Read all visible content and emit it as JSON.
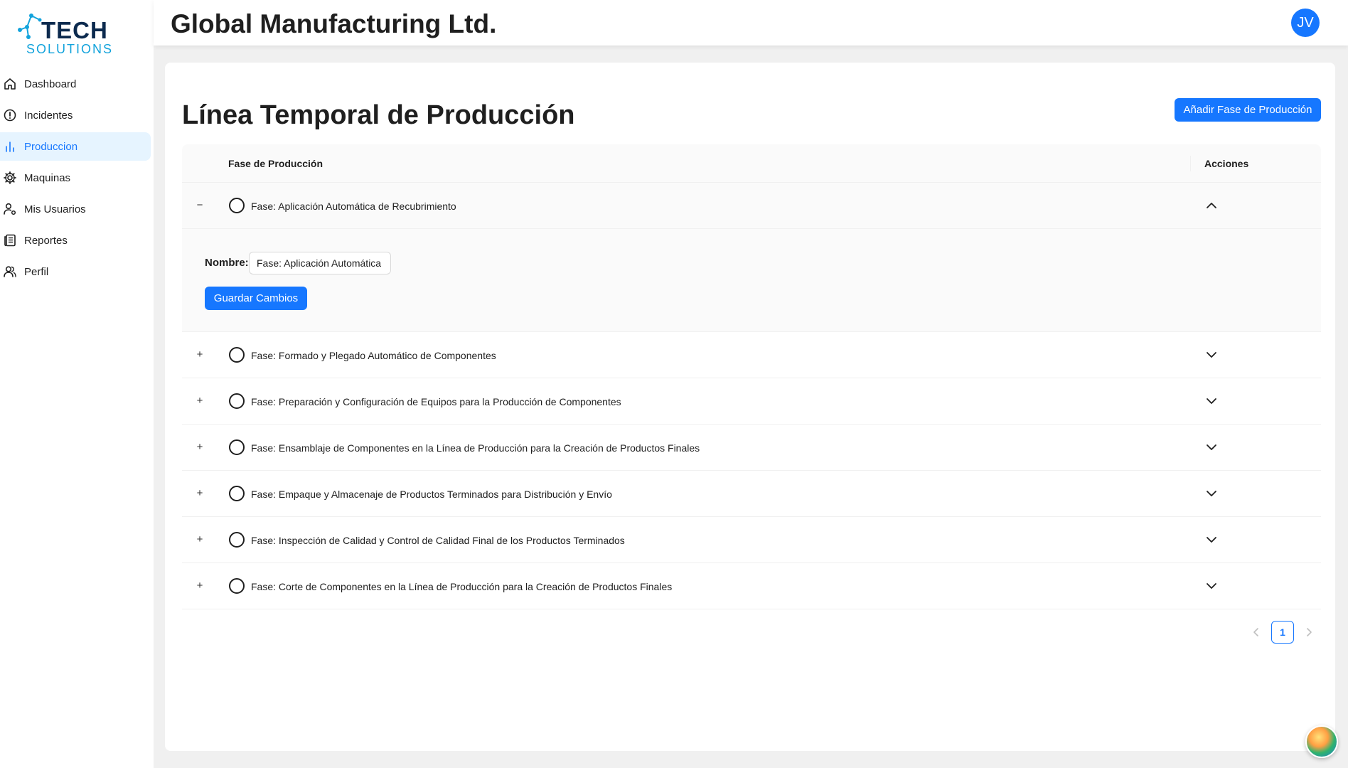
{
  "brand": {
    "logo_main": "TECH",
    "logo_sub": "SOLUTIONS",
    "primary_color": "#1677ff"
  },
  "sidebar": {
    "items": [
      {
        "label": "Dashboard",
        "icon": "home-icon",
        "active": false
      },
      {
        "label": "Incidentes",
        "icon": "alert-circle-icon",
        "active": false
      },
      {
        "label": "Produccion",
        "icon": "bar-chart-icon",
        "active": true
      },
      {
        "label": "Maquinas",
        "icon": "gear-icon",
        "active": false
      },
      {
        "label": "Mis Usuarios",
        "icon": "user-settings-icon",
        "active": false
      },
      {
        "label": "Reportes",
        "icon": "reports-icon",
        "active": false
      },
      {
        "label": "Perfil",
        "icon": "users-icon",
        "active": false
      }
    ]
  },
  "header": {
    "company": "Global Manufacturing Ltd.",
    "avatar_initials": "JV"
  },
  "main": {
    "title": "Línea Temporal de Producción",
    "add_button": "Añadir Fase de Producción",
    "table": {
      "col_phase": "Fase de Producción",
      "col_actions": "Acciones",
      "rows": [
        {
          "name": "Fase: Aplicación Automática de Recubrimiento",
          "expanded": true,
          "expand_symbol": "−"
        },
        {
          "name": "Fase: Formado y Plegado Automático de Componentes",
          "expanded": false,
          "expand_symbol": "+"
        },
        {
          "name": "Fase: Preparación y Configuración de Equipos para la Producción de Componentes",
          "expanded": false,
          "expand_symbol": "+"
        },
        {
          "name": "Fase: Ensamblaje de Componentes en la Línea de Producción para la Creación de Productos Finales",
          "expanded": false,
          "expand_symbol": "+"
        },
        {
          "name": "Fase: Empaque y Almacenaje de Productos Terminados para Distribución y Envío",
          "expanded": false,
          "expand_symbol": "+"
        },
        {
          "name": "Fase: Inspección de Calidad y Control de Calidad Final de los Productos Terminados",
          "expanded": false,
          "expand_symbol": "+"
        },
        {
          "name": "Fase: Corte de Componentes en la Línea de Producción para la Creación de Productos Finales",
          "expanded": false,
          "expand_symbol": "+"
        }
      ]
    },
    "edit_form": {
      "name_label": "Nombre:",
      "name_value": "Fase: Aplicación Automática de Recubrimiento",
      "save_button": "Guardar Cambios"
    },
    "pagination": {
      "current_page": "1"
    }
  }
}
